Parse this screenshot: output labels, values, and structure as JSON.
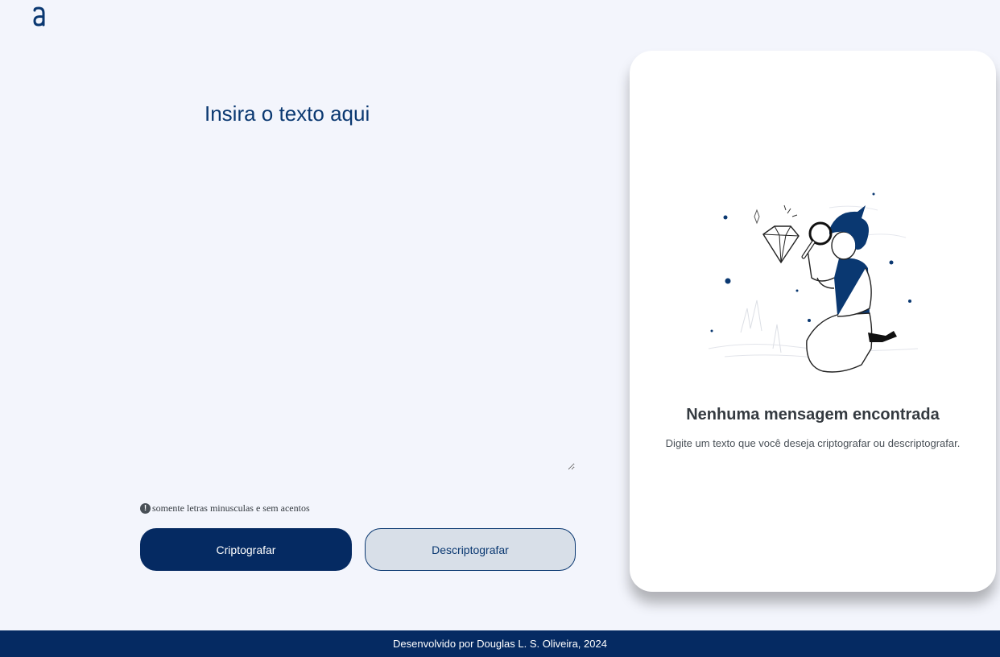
{
  "brand": {
    "logo_icon": "alura-logo-icon",
    "color": "#0a3871"
  },
  "input": {
    "placeholder": "Insira o texto aqui",
    "value": ""
  },
  "hint": {
    "icon": "exclamation-circle-icon",
    "text": "somente letras minusculas e sem acentos"
  },
  "buttons": {
    "encrypt_label": "Criptografar",
    "decrypt_label": "Descriptografar"
  },
  "output": {
    "illustration": "person-with-magnifier-illustration",
    "title": "Nenhuma mensagem encontrada",
    "description": "Digite um texto que você deseja criptografar ou descriptografar."
  },
  "footer": {
    "text": "Desenvolvido por Douglas L. S. Oliveira, 2024"
  },
  "colors": {
    "primary": "#052a62",
    "background": "#f3f5fc",
    "secondary_button": "#d8dfe8"
  }
}
